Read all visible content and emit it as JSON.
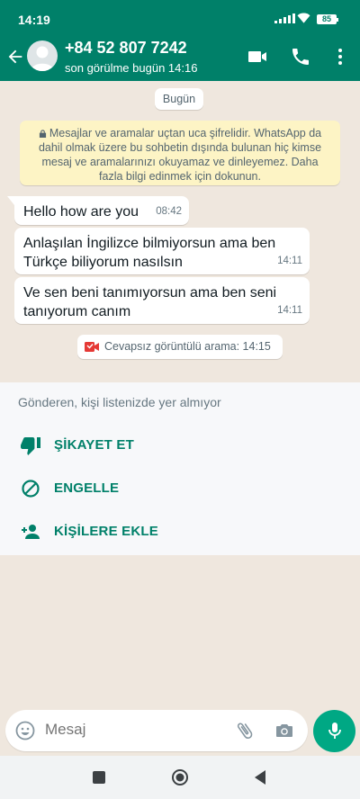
{
  "status_bar": {
    "time": "14:19",
    "battery": "85"
  },
  "header": {
    "contact": "+84 52 807 7242",
    "last_seen": "son görülme bugün 14:16"
  },
  "chat": {
    "date_label": "Bugün",
    "encryption_notice": "Mesajlar ve aramalar uçtan uca şifrelidir. WhatsApp da dahil olmak üzere bu sohbetin dışında bulunan hiç kimse mesaj ve aramalarınızı okuyamaz ve dinleyemez. Daha fazla bilgi edinmek için dokunun.",
    "messages": [
      {
        "text": "Hello how are you",
        "time": "08:42"
      },
      {
        "text": "Anlaşılan İngilizce bilmiyorsun ama ben Türkçe biliyorum nasılsın",
        "time": "14:11"
      },
      {
        "text": "Ve sen beni tanımıyorsun ama ben seni tanıyorum canım",
        "time": "14:11"
      }
    ],
    "missed_call": "Cevapsız görüntülü arama: 14:15"
  },
  "unknown_panel": {
    "note": "Gönderen, kişi listenizde yer almıyor",
    "actions": [
      {
        "label": "ŞİKAYET ET",
        "icon": "thumb-down-icon"
      },
      {
        "label": "ENGELLE",
        "icon": "block-icon"
      },
      {
        "label": "KİŞİLERE EKLE",
        "icon": "add-person-icon"
      }
    ]
  },
  "composer": {
    "placeholder": "Mesaj"
  },
  "colors": {
    "brand": "#008069",
    "accent": "#00a884",
    "chat_bg": "#efe7de",
    "missed_call": "#e53935"
  }
}
